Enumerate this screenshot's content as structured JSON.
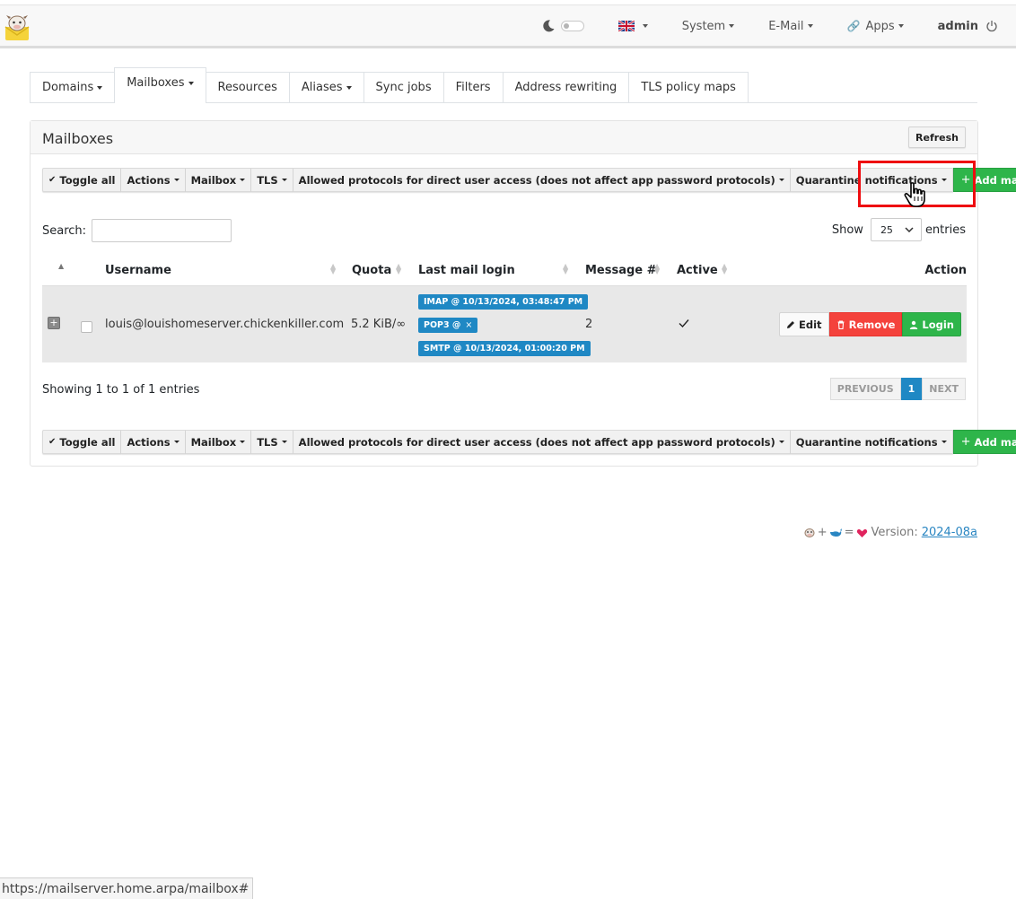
{
  "navbar": {
    "items": [
      {
        "label": "System"
      },
      {
        "label": "E-Mail"
      },
      {
        "label": "Apps"
      }
    ],
    "user": "admin"
  },
  "tabs": [
    {
      "label": "Domains",
      "dropdown": true
    },
    {
      "label": "Mailboxes",
      "dropdown": true,
      "active": true
    },
    {
      "label": "Resources"
    },
    {
      "label": "Aliases",
      "dropdown": true
    },
    {
      "label": "Sync jobs"
    },
    {
      "label": "Filters"
    },
    {
      "label": "Address rewriting"
    },
    {
      "label": "TLS policy maps"
    }
  ],
  "panel": {
    "title": "Mailboxes",
    "refresh_label": "Refresh"
  },
  "toolbar": {
    "toggle_all": "Toggle all",
    "actions": "Actions",
    "mailbox": "Mailbox",
    "tls": "TLS",
    "protocols": "Allowed protocols for direct user access (does not affect app password protocols)",
    "quarantine": "Quarantine notifications",
    "add_mailbox": "Add mailbox"
  },
  "search": {
    "label": "Search:",
    "value": ""
  },
  "show": {
    "prefix": "Show",
    "value": "25",
    "suffix": "entries"
  },
  "table": {
    "headers": {
      "username": "Username",
      "quota": "Quota",
      "last_login": "Last mail login",
      "messages": "Message #",
      "active": "Active",
      "action": "Action"
    },
    "rows": [
      {
        "username": "louis@louishomeserver.chickenkiller.com",
        "quota": "5.2 KiB/∞",
        "imap": "IMAP @ 10/13/2024, 03:48:47 PM",
        "pop3": "POP3 @",
        "pop3_x": "×",
        "smtp": "SMTP @ 10/13/2024, 01:00:20 PM",
        "messages": "2",
        "edit": "Edit",
        "remove": "Remove",
        "login": "Login"
      }
    ]
  },
  "pagination": {
    "info": "Showing 1 to 1 of 1 entries",
    "previous": "PREVIOUS",
    "current": "1",
    "next": "NEXT"
  },
  "footer": {
    "eq_plus": "+",
    "eq_equals": "=",
    "version_label": "Version:",
    "version": "2024-08a"
  },
  "status_url": "https://mailserver.home.arpa/mailbox#",
  "colors": {
    "primary": "#1f88c4",
    "success": "#2eb54a",
    "danger": "#f4423c",
    "highlight": "#ee0d10"
  }
}
